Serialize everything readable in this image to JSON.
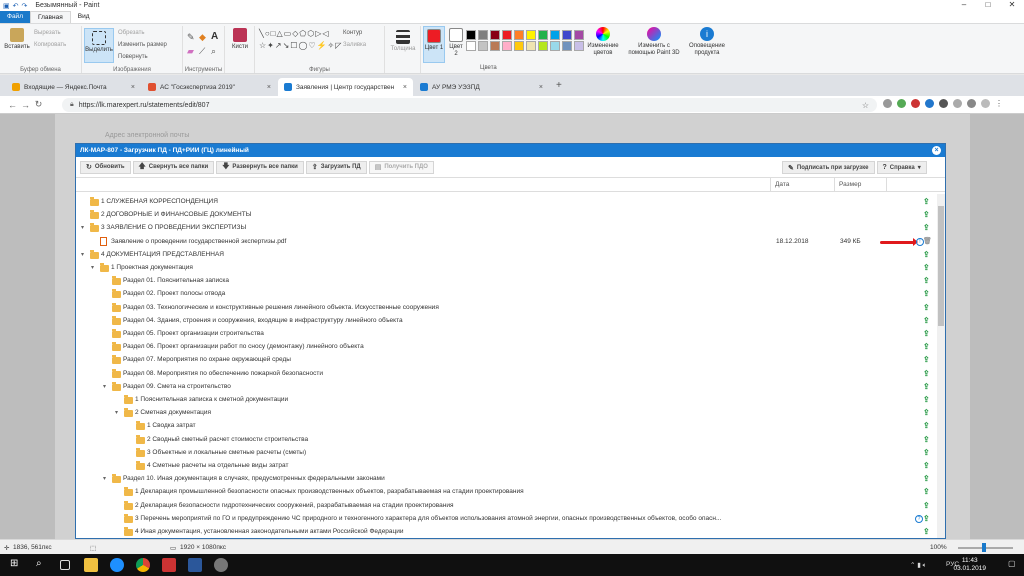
{
  "paint": {
    "window_title": "Безымянный - Paint",
    "tabs": [
      "Файл",
      "Главная",
      "Вид"
    ],
    "clipboard": {
      "paste": "Вставить",
      "cut": "Вырезать",
      "copy": "Копировать",
      "caption": "Буфер обмена"
    },
    "image": {
      "select": "Выделить",
      "crop": "Обрезать",
      "resize": "Изменить размер",
      "rotate": "Повернуть",
      "caption": "Изображения"
    },
    "tools_caption": "Инструменты",
    "brushes": "Кисти",
    "shapes": {
      "outline": "Контур",
      "fill": "Заливка",
      "caption": "Фигуры"
    },
    "thickness": "Толщина",
    "color1": "Цвет 1",
    "color2": "Цвет 2",
    "colors_caption": "Цвета",
    "edit_colors": "Изменение цветов",
    "paint3d": "Изменить с помощью Paint 3D",
    "alerts": "Оповещение продукта",
    "swatches": [
      "#000000",
      "#7f7f7f",
      "#880015",
      "#ed1c24",
      "#ff7f27",
      "#fff200",
      "#22b14c",
      "#00a2e8",
      "#3f48cc",
      "#a349a4",
      "#ffffff",
      "#c3c3c3",
      "#b97a57",
      "#ffaec9",
      "#ffc90e",
      "#efe4b0",
      "#b5e61d",
      "#99d9ea",
      "#7092be",
      "#c8bfe7"
    ],
    "status": {
      "cursor": "1836, 561пкс",
      "size": "1920 × 1080пкс",
      "zoom": "100%"
    }
  },
  "browser": {
    "tabs": [
      {
        "title": "Входящие — Яндекс.Почта",
        "color": "#f0a000"
      },
      {
        "title": "АС \"Госэкспертиза 2019\"",
        "color": "#e05030"
      },
      {
        "title": "Заявления | Центр государствен",
        "color": "#1a7bd2"
      },
      {
        "title": "АУ РМЭ УЭЗПД",
        "color": "#1a7bd2"
      }
    ],
    "url": "https://lk.marexpert.ru/statements/edit/807"
  },
  "page_bg": {
    "text1": "Адрес электронной почты"
  },
  "modal": {
    "title": "ЛК-МАР-807 - Загрузчик ПД - ПД+РИИ (ГЦ) линейный",
    "toolbar": {
      "refresh": "Обновить",
      "collapse": "Свернуть все папки",
      "expand": "Развернуть все папки",
      "upload": "Загрузить ПД",
      "get_pdo": "Получить ПДО",
      "sign": "Подписать при загрузке",
      "help": "Справка"
    },
    "columns": {
      "date": "Дата",
      "size": "Размер"
    },
    "rows": [
      {
        "label": "1 СЛУЖЕБНАЯ КОРРЕСПОНДЕНЦИЯ",
        "level": 0,
        "caret": ""
      },
      {
        "label": "2 ДОГОВОРНЫЕ И ФИНАНСОВЫЕ ДОКУМЕНТЫ",
        "level": 0,
        "caret": ""
      },
      {
        "label": "3 ЗАЯВЛЕНИЕ О ПРОВЕДЕНИИ ЭКСПЕРТИЗЫ",
        "level": 0,
        "caret": "▾"
      },
      {
        "label": "Заявление о проведении государственной экспертизы.pdf",
        "level": 1,
        "caret": "",
        "file": true,
        "date": "18.12.2018",
        "size": "349 КБ"
      },
      {
        "label": "4 ДОКУМЕНТАЦИЯ ПРЕДСТАВЛЕННАЯ",
        "level": 0,
        "caret": "▾"
      },
      {
        "label": "1 Проектная документация",
        "level": 1,
        "caret": "▾"
      },
      {
        "label": "Раздел 01. Пояснительная записка",
        "level": 2,
        "caret": ""
      },
      {
        "label": "Раздел 02. Проект полосы отвода",
        "level": 2,
        "caret": ""
      },
      {
        "label": "Раздел 03. Технологические и конструктивные решения линейного объекта. Искусственные сооружения",
        "level": 2,
        "caret": ""
      },
      {
        "label": "Раздел 04. Здания, строения и сооружения, входящие в инфраструктуру линейного объекта",
        "level": 2,
        "caret": ""
      },
      {
        "label": "Раздел 05. Проект организации строительства",
        "level": 2,
        "caret": ""
      },
      {
        "label": "Раздел 06. Проект организации работ по сносу (демонтажу) линейного объекта",
        "level": 2,
        "caret": ""
      },
      {
        "label": "Раздел 07. Мероприятия по охране окружающей среды",
        "level": 2,
        "caret": ""
      },
      {
        "label": "Раздел 08. Мероприятия по обеспечению пожарной безопасности",
        "level": 2,
        "caret": ""
      },
      {
        "label": "Раздел 09. Смета на строительство",
        "level": 2,
        "caret": "▾"
      },
      {
        "label": "1 Пояснительная записка к сметной документации",
        "level": 3,
        "caret": ""
      },
      {
        "label": "2 Сметная документация",
        "level": 3,
        "caret": "▾"
      },
      {
        "label": "1 Сводка затрат",
        "level": 4,
        "caret": ""
      },
      {
        "label": "2 Сводный сметный расчет стоимости строительства",
        "level": 4,
        "caret": ""
      },
      {
        "label": "3 Объектные и локальные сметные расчеты (сметы)",
        "level": 4,
        "caret": ""
      },
      {
        "label": "4 Сметные расчеты на отдельные виды затрат",
        "level": 4,
        "caret": ""
      },
      {
        "label": "Раздел 10. Иная документация в случаях, предусмотренных федеральными законами",
        "level": 2,
        "caret": "▾"
      },
      {
        "label": "1 Декларация промышленной безопасности опасных производственных объектов, разрабатываемая на стадии проектирования",
        "level": 3,
        "caret": ""
      },
      {
        "label": "2 Декларация безопасности гидротехнических сооружений, разрабатываемая на стадии проектирования",
        "level": 3,
        "caret": ""
      },
      {
        "label": "3 Перечень мероприятий по ГО и предупреждению ЧС природного и техногенного характера для объектов использования атомной энергии, опасных производственных объектов, особо опасн...",
        "level": 3,
        "caret": "",
        "help": true
      },
      {
        "label": "4 Иная документация, установленная законодательными актами Российской Федерации",
        "level": 3,
        "caret": ""
      }
    ]
  },
  "taskbar": {
    "lang": "РУС",
    "time": "11:43",
    "date": "03.01.2019"
  }
}
